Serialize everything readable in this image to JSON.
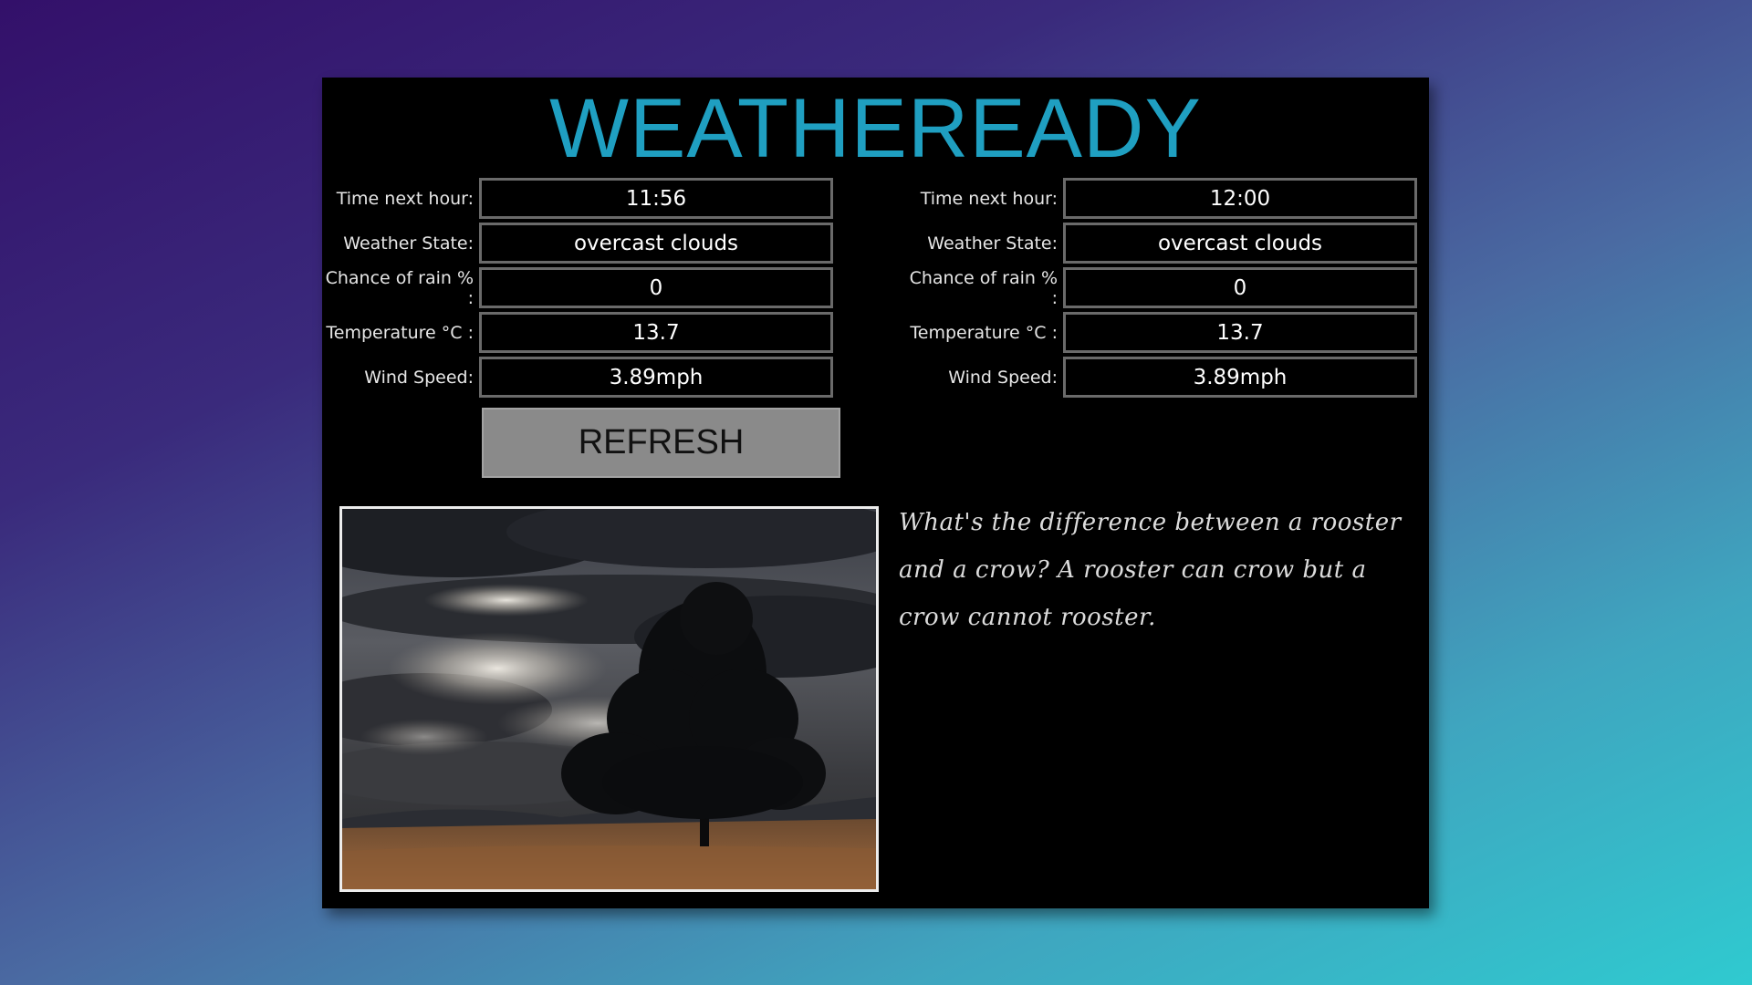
{
  "app": {
    "title": "WEATHEREADY",
    "title_color": "#1f9fc1",
    "background_color": "#000000"
  },
  "forecast_left": {
    "rows": [
      {
        "label": "Time next hour:",
        "value": "11:56"
      },
      {
        "label": "Weather State:",
        "value": "overcast clouds"
      },
      {
        "label": "Chance of rain % :",
        "value": "0"
      },
      {
        "label": "Temperature °C :",
        "value": "13.7"
      },
      {
        "label": "Wind Speed:",
        "value": "3.89mph"
      }
    ]
  },
  "forecast_right": {
    "rows": [
      {
        "label": "Time next hour:",
        "value": "12:00"
      },
      {
        "label": "Weather State:",
        "value": "overcast clouds"
      },
      {
        "label": "Chance of rain % :",
        "value": "0"
      },
      {
        "label": "Temperature °C :",
        "value": "13.7"
      },
      {
        "label": "Wind Speed:",
        "value": "3.89mph"
      }
    ]
  },
  "refresh": {
    "label": "REFRESH"
  },
  "image": {
    "subject": "tree-under-overcast-clouds"
  },
  "joke": {
    "text": "What's the difference between a rooster and a crow? A rooster can crow but a crow cannot rooster."
  }
}
